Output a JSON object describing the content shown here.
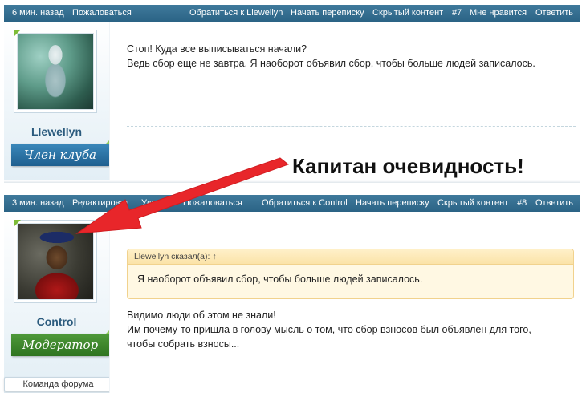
{
  "post1": {
    "bar": {
      "time": "6 мин. назад",
      "report": "Пожаловаться",
      "contact": "Обратиться к Llewellyn",
      "start_convo": "Начать переписку",
      "hidden": "Скрытый контент",
      "number": "#7",
      "like": "Мне нравится",
      "reply": "Ответить"
    },
    "author": {
      "name": "Llewellyn",
      "rank": "Член клуба"
    },
    "message": {
      "line1": "Стоп! Куда все выписываться начали?",
      "line2": "Ведь сбор еще не завтра. Я наоборот объявил сбор, чтобы больше людей записалось."
    }
  },
  "post2": {
    "bar": {
      "time": "3 мин. назад",
      "edit": "Редактироват",
      "delete": "Удалить",
      "report": "Пожаловаться",
      "contact": "Обратиться к Control",
      "start_convo": "Начать переписку",
      "hidden": "Скрытый контент",
      "number": "#8",
      "reply": "Ответить"
    },
    "author": {
      "name": "Control",
      "rank": "Модератор",
      "team_badge": "Команда форума"
    },
    "quote": {
      "header": "Llewellyn сказал(а): ↑",
      "text": "Я наоборот объявил сбор, чтобы больше людей записалось."
    },
    "message": {
      "line1": "Видимо люди об этом не знали!",
      "line2": "Им почему-то пришла в голову мысль о том, что сбор взносов был объявлен для того,",
      "line3": "чтобы собрать взносы..."
    }
  },
  "annotation": {
    "caption": "Капитан очевидность!",
    "arrow_color": "#e8262a"
  },
  "colors": {
    "bar": "#2f6a8c",
    "username": "#2b5b7e",
    "rank_member": "#2a6fa0",
    "rank_moderator": "#3a8429"
  }
}
